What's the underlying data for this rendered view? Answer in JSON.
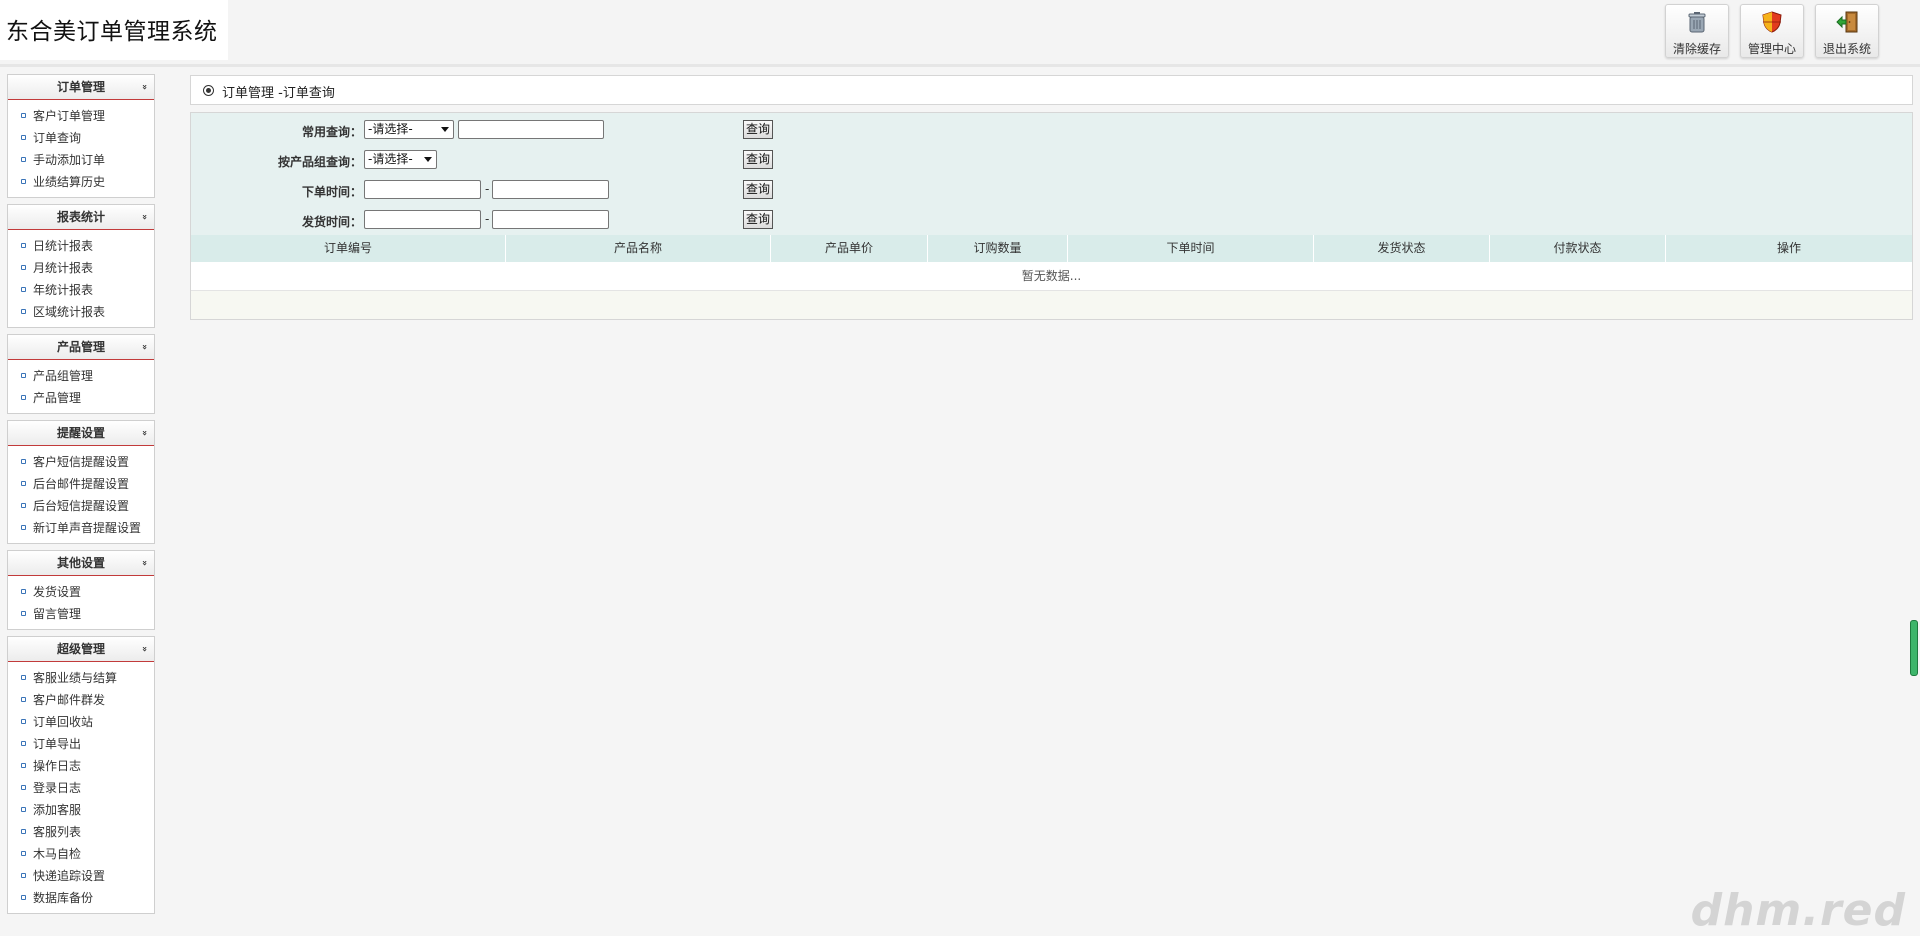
{
  "header": {
    "app_title": "东合美订单管理系统",
    "buttons": [
      {
        "label": "清除缓存",
        "icon": "trash-can-icon"
      },
      {
        "label": "管理中心",
        "icon": "shield-icon"
      },
      {
        "label": "退出系统",
        "icon": "exit-door-icon"
      }
    ]
  },
  "sidebar": {
    "groups": [
      {
        "title": "订单管理",
        "items": [
          "客户订单管理",
          "订单查询",
          "手动添加订单",
          "业绩结算历史"
        ]
      },
      {
        "title": "报表统计",
        "items": [
          "日统计报表",
          "月统计报表",
          "年统计报表",
          "区域统计报表"
        ]
      },
      {
        "title": "产品管理",
        "items": [
          "产品组管理",
          "产品管理"
        ]
      },
      {
        "title": "提醒设置",
        "items": [
          "客户短信提醒设置",
          "后台邮件提醒设置",
          "后台短信提醒设置",
          "新订单声音提醒设置"
        ]
      },
      {
        "title": "其他设置",
        "items": [
          "发货设置",
          "留言管理"
        ]
      },
      {
        "title": "超级管理",
        "items": [
          "客服业绩与结算",
          "客户邮件群发",
          "订单回收站",
          "订单导出",
          "操作日志",
          "登录日志",
          "添加客服",
          "客服列表",
          "木马自检",
          "快递追踪设置",
          "数据库备份"
        ]
      }
    ],
    "chevron_glyph": "»"
  },
  "main": {
    "breadcrumb": "订单管理 -订单查询",
    "search": {
      "common_label": "常用查询：",
      "common_select": "-请选择-",
      "group_label": "按产品组查询：",
      "group_select": "-请选择-",
      "order_time_label": "下单时间：",
      "ship_time_label": "发货时间：",
      "range_separator": "-",
      "query_button": "查询"
    },
    "table": {
      "columns": [
        "订单编号",
        "产品名称",
        "产品单价",
        "订购数量",
        "下单时间",
        "发货状态",
        "付款状态",
        "操作"
      ],
      "empty_text": "暂无数据..."
    }
  },
  "watermark": "dhm.red",
  "colors": {
    "search_bg": "#e6f1f0",
    "table_header_bg": "#d9ecea",
    "menu_divider": "#c23a3a",
    "scroll_accent": "#3db56a"
  }
}
